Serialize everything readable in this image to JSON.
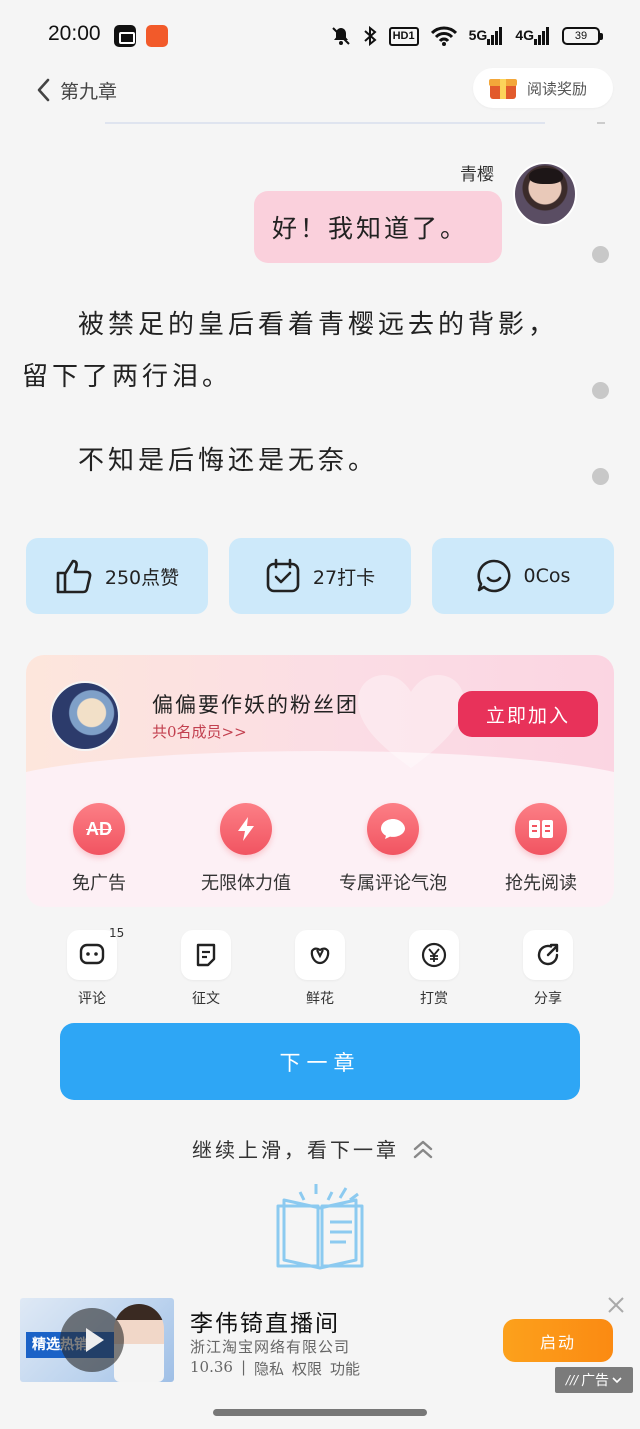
{
  "status_bar": {
    "time": "20:00",
    "battery": "39",
    "network_5g": "5G",
    "network_4g": "4G",
    "hd_label": "HD1"
  },
  "nav": {
    "chapter_title": "第九章",
    "reward_label": "阅读奖励"
  },
  "chat": {
    "speaker": "青樱",
    "message": "好！我知道了。"
  },
  "content": {
    "paragraph1_line1": "被禁足的皇后看着青樱远去的背影，",
    "paragraph1_line2": "留下了两行泪。",
    "paragraph2": "不知是后悔还是无奈。"
  },
  "actions": {
    "like_label": "250点赞",
    "checkin_label": "27打卡",
    "cos_label": "0Cos"
  },
  "fan_club": {
    "title": "偏偏要作妖的粉丝团",
    "members": "共0名成员>>",
    "join_label": "立即加入",
    "perks": [
      {
        "icon": "AD",
        "label": "免广告"
      },
      {
        "icon": "lightning-icon",
        "label": "无限体力值"
      },
      {
        "icon": "chat-bubble-icon",
        "label": "专属评论气泡"
      },
      {
        "icon": "book-icon",
        "label": "抢先阅读"
      }
    ]
  },
  "tools": [
    {
      "label": "评论",
      "badge": "15"
    },
    {
      "label": "征文"
    },
    {
      "label": "鲜花"
    },
    {
      "label": "打赏"
    },
    {
      "label": "分享"
    }
  ],
  "next_chapter_label": "下一章",
  "swipe_hint": "继续上滑，看下一章",
  "ad": {
    "title": "李伟锜直播间",
    "company": "浙江淘宝网络有限公司",
    "version": "10.36",
    "privacy": "隐私",
    "permissions": "权限",
    "features": "功能",
    "launch_label": "启动",
    "tag_label": "广告",
    "thumb_banner": "精选热销"
  },
  "colors": {
    "accent_blue": "#2ea6f5",
    "card_blue": "#cde9fa",
    "bubble_pink": "#fad0dc",
    "join_red": "#e8325a",
    "ad_orange": "#fca11c"
  }
}
